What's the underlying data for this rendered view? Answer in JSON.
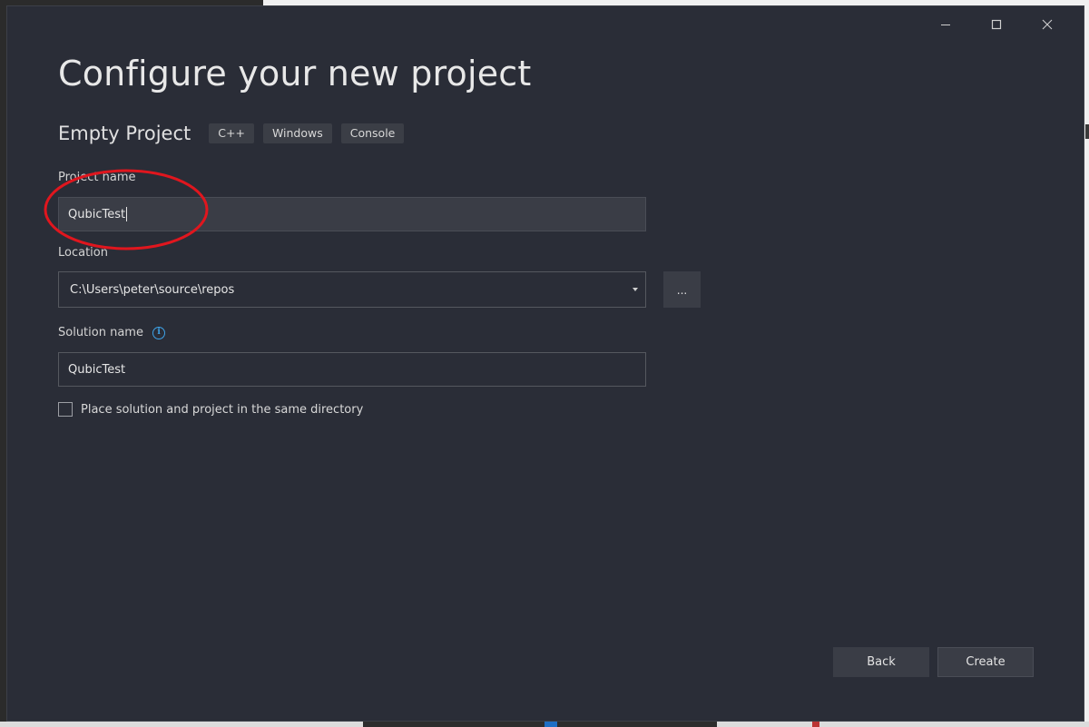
{
  "window": {
    "minimize_icon": "minimize-icon",
    "maximize_icon": "maximize-icon",
    "close_icon": "close-icon"
  },
  "title": "Configure your new project",
  "template": {
    "name": "Empty Project",
    "tags": [
      "C++",
      "Windows",
      "Console"
    ]
  },
  "fields": {
    "project_name": {
      "label": "Project name",
      "value": "QubicTest"
    },
    "location": {
      "label": "Location",
      "value": "C:\\Users\\peter\\source\\repos",
      "browse_label": "..."
    },
    "solution_name": {
      "label": "Solution name",
      "value": "QubicTest",
      "info_icon": "info-icon"
    }
  },
  "checkbox": {
    "label": "Place solution and project in the same directory",
    "checked": false
  },
  "buttons": {
    "back": "Back",
    "create": "Create"
  },
  "colors": {
    "dialog_bg": "#2a2d37",
    "annotation": "#e0161e",
    "info_accent": "#3ea3e8"
  }
}
